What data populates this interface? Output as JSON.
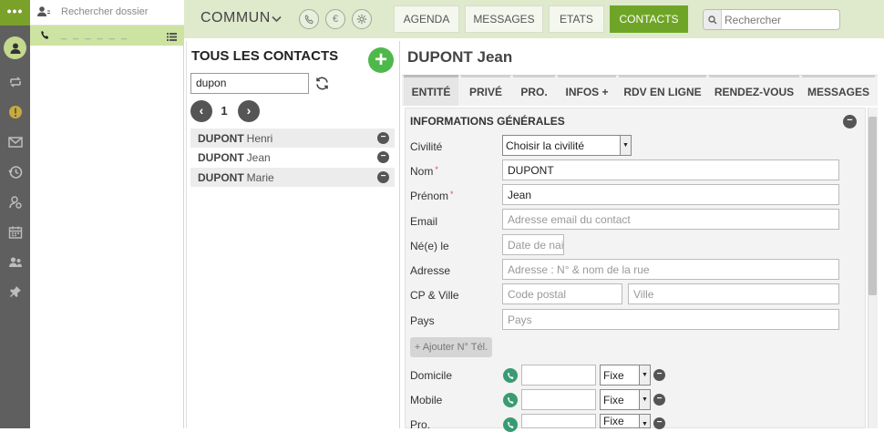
{
  "rail": {
    "top_glyph": "•••",
    "icons": [
      "user-icon",
      "transfer-icon",
      "alert-icon",
      "envelope-icon",
      "history-icon",
      "user-settings-icon",
      "calendar-icon",
      "users-icon",
      "pin-icon"
    ]
  },
  "folder_panel": {
    "search_placeholder": "Rechercher dossier",
    "active_item_placeholder": "_ _ _ _ _ _"
  },
  "header": {
    "title": "COMMUN",
    "currency_glyph": "€",
    "nav": [
      "AGENDA",
      "MESSAGES",
      "ETATS",
      "CONTACTS"
    ],
    "active_nav": "CONTACTS",
    "search_placeholder": "Rechercher"
  },
  "contacts_list": {
    "title": "TOUS LES CONTACTS",
    "add_glyph": "+",
    "search_value": "dupon",
    "page": "1",
    "prev_glyph": "‹",
    "next_glyph": "›",
    "remove_glyph": "−",
    "items": [
      {
        "last": "DUPONT",
        "first": "Henri"
      },
      {
        "last": "DUPONT",
        "first": "Jean"
      },
      {
        "last": "DUPONT",
        "first": "Marie"
      }
    ]
  },
  "detail": {
    "title": "DUPONT Jean",
    "tabs": [
      "ENTITÉ",
      "PRIVÉ",
      "PRO.",
      "INFOS +",
      "RDV EN LIGNE",
      "RENDEZ-VOUS",
      "MESSAGES"
    ],
    "active_tab": "ENTITÉ",
    "section_title": "INFORMATIONS GÉNÉRALES",
    "section_toggle_glyph": "−",
    "required_mark": "*",
    "fields": {
      "civilite": {
        "label": "Civilité",
        "value": "Choisir la civilité"
      },
      "nom": {
        "label": "Nom",
        "value": "DUPONT"
      },
      "prenom": {
        "label": "Prénom",
        "value": "Jean"
      },
      "email": {
        "label": "Email",
        "placeholder": "Adresse email du contact"
      },
      "naissance": {
        "label": "Né(e) le",
        "placeholder": "Date de nais"
      },
      "adresse": {
        "label": "Adresse",
        "placeholder": "Adresse : N° & nom de la rue"
      },
      "cp_ville": {
        "label": "CP & Ville",
        "cp_placeholder": "Code postal",
        "ville_placeholder": "Ville"
      },
      "pays": {
        "label": "Pays",
        "placeholder": "Pays"
      }
    },
    "add_phone_label": "+ Ajouter N° Tél.",
    "phones": [
      {
        "label": "Domicile",
        "type": "Fixe"
      },
      {
        "label": "Mobile",
        "type": "Fixe"
      },
      {
        "label": "Pro.",
        "type": "Fixe"
      }
    ]
  },
  "colors": {
    "accent_green": "#6fa526",
    "header_bg": "#dfe9cc",
    "rail_bg": "#5f5f5f",
    "phone_icon": "#3a9b73"
  }
}
